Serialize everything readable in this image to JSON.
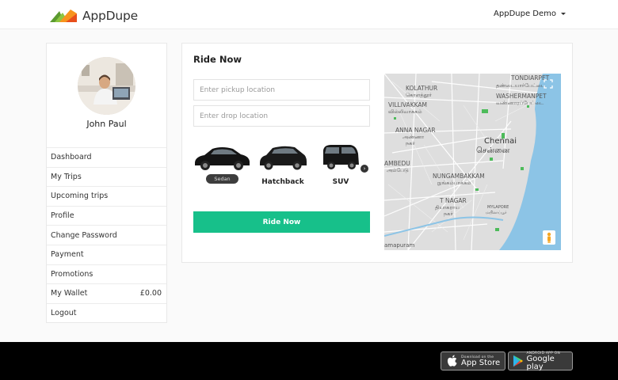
{
  "header": {
    "app_name": "AppDupe",
    "user_menu_label": "AppDupe Demo"
  },
  "sidebar": {
    "profile_name": "John Paul",
    "items": [
      {
        "label": "Dashboard"
      },
      {
        "label": "My Trips"
      },
      {
        "label": "Upcoming trips"
      },
      {
        "label": "Profile"
      },
      {
        "label": "Change Password"
      },
      {
        "label": "Payment"
      },
      {
        "label": "Promotions"
      },
      {
        "label": "My Wallet",
        "amount": "£0.00"
      },
      {
        "label": "Logout"
      }
    ]
  },
  "main": {
    "title": "Ride Now",
    "pickup_placeholder": "Enter pickup location",
    "drop_placeholder": "Enter drop location",
    "cars": [
      {
        "label": "Sedan",
        "selected": true
      },
      {
        "label": "Hatchback",
        "selected": false
      },
      {
        "label": "SUV",
        "selected": false
      }
    ],
    "ride_button": "Ride Now",
    "map": {
      "labels": [
        {
          "text": "KOLATHUR"
        },
        {
          "text": "கொளத்தூர்"
        },
        {
          "text": "VILLIVAKKAM"
        },
        {
          "text": "வில்லிவாக்கம்"
        },
        {
          "text": "TONDIARPET"
        },
        {
          "text": "தண்டையார்பேட்டை"
        },
        {
          "text": "WASHERMANPET"
        },
        {
          "text": "வண்ணாரப்பேட்டை"
        },
        {
          "text": "ANNA NAGAR"
        },
        {
          "text": "அண்ணா"
        },
        {
          "text": "நகர்"
        },
        {
          "text": "Chennai"
        },
        {
          "text": "சென்னை"
        },
        {
          "text": "AMBEDU"
        },
        {
          "text": "அம்பேடு"
        },
        {
          "text": "NUNGAMBAKKAM"
        },
        {
          "text": "நுங்கம்பாக்கம்"
        },
        {
          "text": "T NAGAR"
        },
        {
          "text": "தியாகராய"
        },
        {
          "text": "நகர்"
        },
        {
          "text": "MYLAPORE"
        },
        {
          "text": "மயிலாப்பூர்"
        },
        {
          "text": "amapuram"
        }
      ]
    }
  },
  "footer": {
    "appstore_small": "Download on the",
    "appstore_big": "App Store",
    "googleplay_small": "ANDROID APP ON",
    "googleplay_big": "Google play"
  },
  "colors": {
    "accent": "#17c08a",
    "footer_bg": "#000000",
    "logo_green": "#8cc63f",
    "logo_orange": "#f7941d",
    "logo_red": "#e84e1b",
    "map_water": "#8cc4e6"
  }
}
